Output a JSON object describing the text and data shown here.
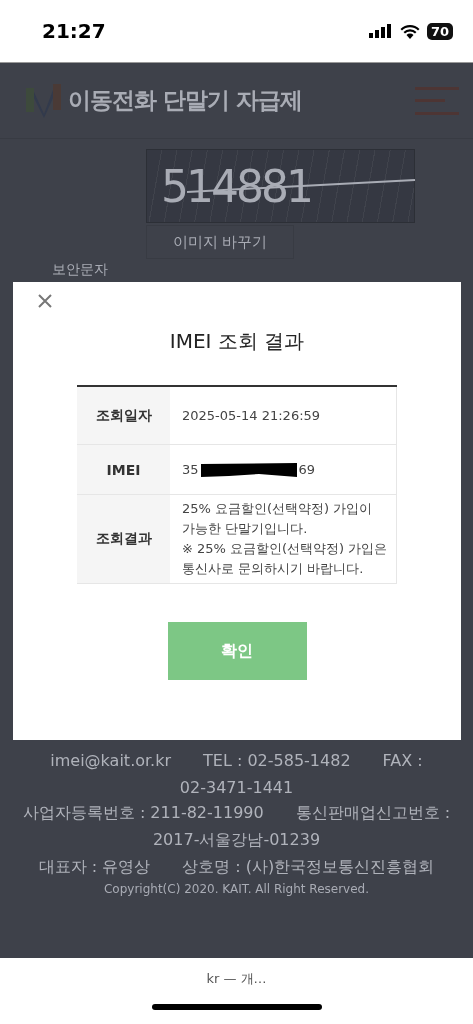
{
  "status_bar": {
    "time": "21:27",
    "battery": "70"
  },
  "header": {
    "title": "이동전화 단말기 자급제"
  },
  "captcha": {
    "code": "514881",
    "refresh_button": "이미지 바꾸기",
    "label": "보안문자"
  },
  "modal": {
    "title": "IMEI 조회 결과",
    "rows": [
      {
        "kind": "text",
        "label": "조회일자",
        "value": "2025-05-14 21:26:59"
      },
      {
        "kind": "redacted",
        "label": "IMEI",
        "prefix": "35",
        "suffix": "69"
      },
      {
        "kind": "text",
        "label": "조회결과",
        "value": "25% 요금할인(선택약정) 가입이 가능한 단말기입니다.\n※ 25% 요금할인(선택약정) 가입은 통신사로 문의하시기 바랍니다."
      }
    ],
    "confirm_button": "확인"
  },
  "footer": {
    "lines": [
      "imei@kait.or.kr　　TEL : 02-585-1482　　FAX :",
      "02-3471-1441",
      "사업자등록번호 : 211-82-11990　　통신판매업신고번호 :",
      "2017-서울강남-01239",
      "대표자 : 유영상　　상호명 : (사)한국정보통신진흥협회"
    ],
    "copyright": "Copyright(C) 2020. KAIT. All Right Reserved."
  },
  "address_bar": {
    "url": "kr — 개…"
  }
}
